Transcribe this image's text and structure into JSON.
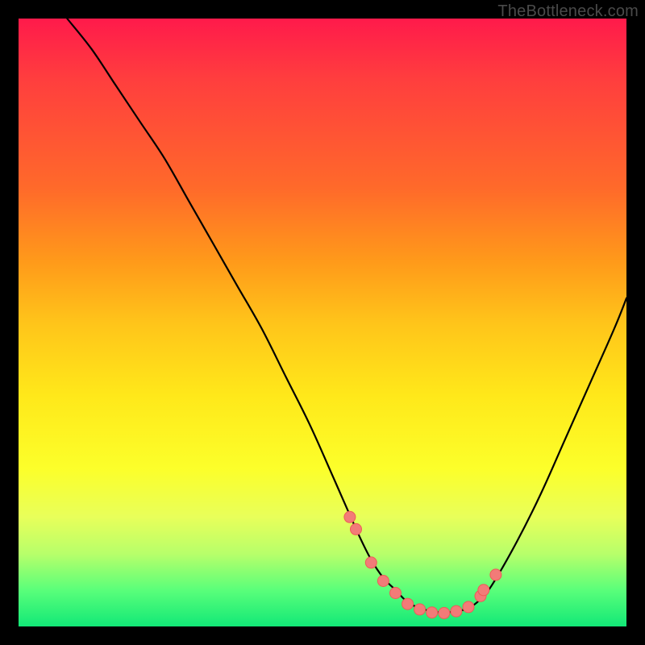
{
  "watermark": "TheBottleneck.com",
  "colors": {
    "frame": "#000000",
    "curve": "#000000",
    "marker_fill": "#f27b78",
    "marker_stroke": "#ef5b57",
    "gradient_stops": [
      "#ff1a4b",
      "#ff3e3e",
      "#ff6a2a",
      "#ff9a1a",
      "#ffc41a",
      "#ffe81a",
      "#fcff2a",
      "#e8ff5a",
      "#b8ff6a",
      "#5aff7a",
      "#12e877"
    ]
  },
  "chart_data": {
    "type": "line",
    "title": "",
    "xlabel": "",
    "ylabel": "",
    "xlim": [
      0,
      100
    ],
    "ylim": [
      0,
      100
    ],
    "series": [
      {
        "name": "curve",
        "x": [
          8,
          12,
          16,
          20,
          24,
          28,
          32,
          36,
          40,
          44,
          48,
          52,
          56,
          58,
          60,
          62,
          64,
          66,
          68,
          70,
          72,
          74,
          76,
          78,
          82,
          86,
          90,
          94,
          98,
          100
        ],
        "y": [
          100,
          95,
          89,
          83,
          77,
          70,
          63,
          56,
          49,
          41,
          33,
          24,
          15,
          11,
          8,
          6,
          4,
          3,
          2.5,
          2.3,
          2.5,
          3,
          4.5,
          7,
          14,
          22,
          31,
          40,
          49,
          54
        ]
      }
    ],
    "markers": {
      "x": [
        54.5,
        55.5,
        58,
        60,
        62,
        64,
        66,
        68,
        70,
        72,
        74,
        76,
        76.5,
        78.5
      ],
      "y": [
        18,
        16,
        10.5,
        7.5,
        5.5,
        3.7,
        2.8,
        2.3,
        2.2,
        2.5,
        3.2,
        5,
        6,
        8.5
      ]
    }
  }
}
